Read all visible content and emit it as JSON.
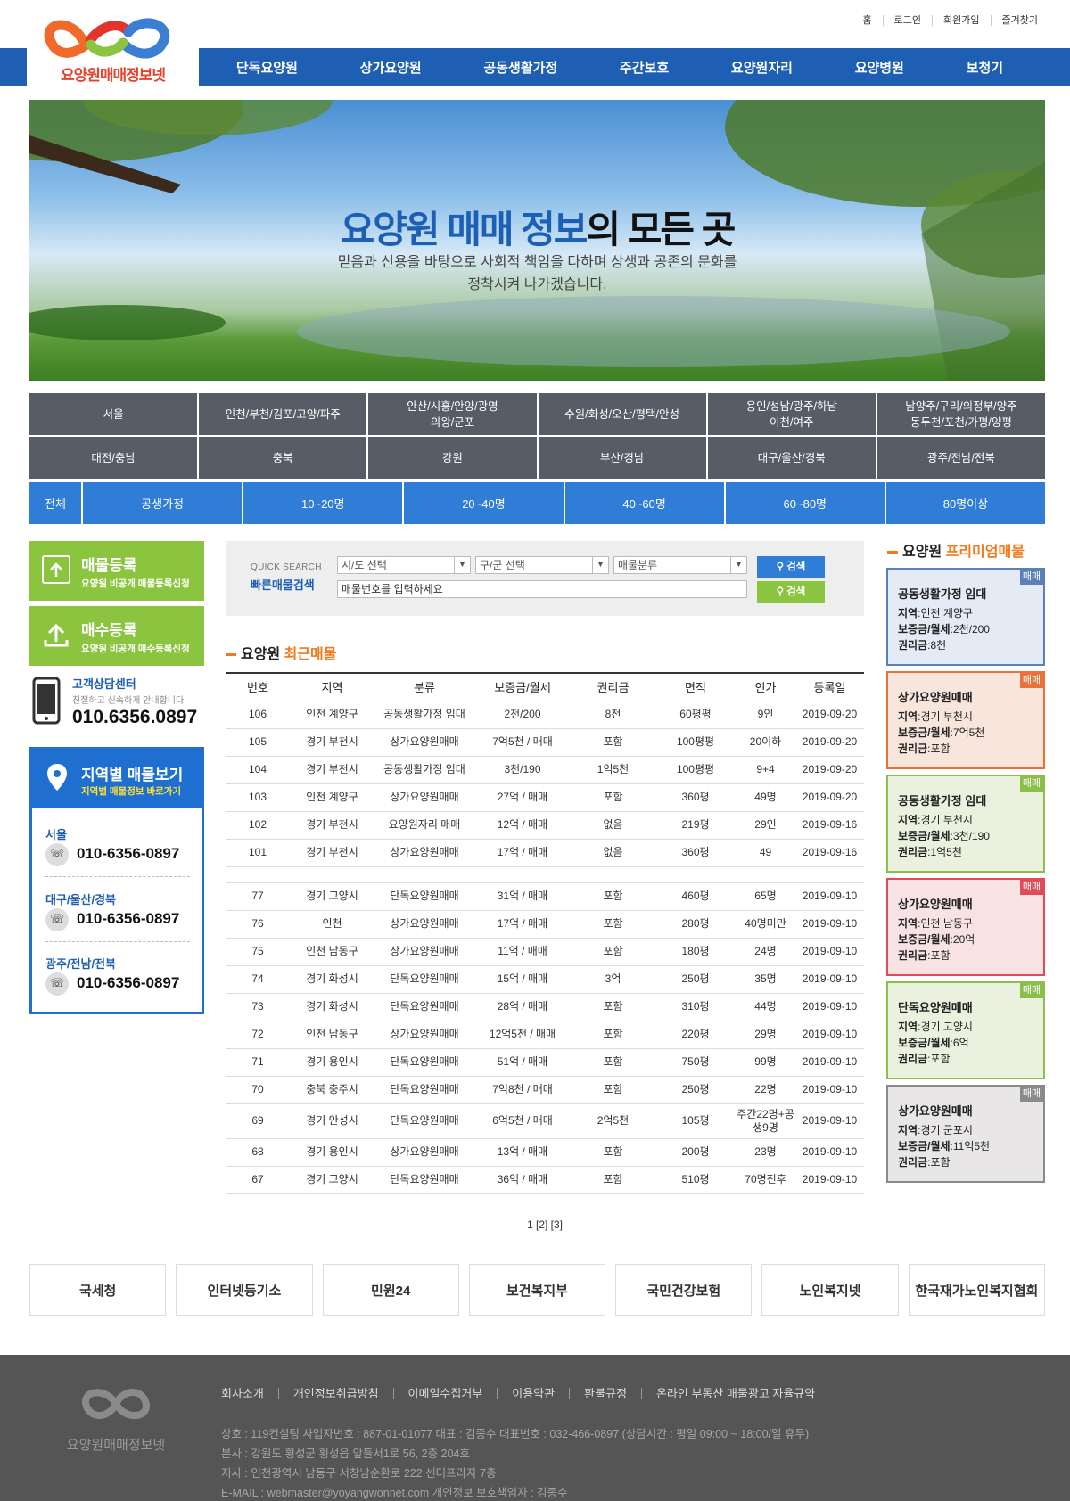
{
  "top_links": [
    "홈",
    "로그인",
    "회원가입",
    "즐겨찾기"
  ],
  "logo": {
    "text": "요양원매매정보넷"
  },
  "nav": [
    "단독요양원",
    "상가요양원",
    "공동생활가정",
    "주간보호",
    "요양원자리",
    "요양병원",
    "보청기"
  ],
  "hero": {
    "title_blue": "요양원 매매 정보",
    "title_dark": "의 모든 곳",
    "sub1": "믿음과 신용을 바탕으로 사회적 책임을 다하며 상생과 공존의 문화를",
    "sub2": "정착시켜 나가겠습니다."
  },
  "regions_row1": [
    "서울",
    "인천/부천/김포/고양/파주",
    "안산/시흥/안양/광명\n의왕/군포",
    "수원/화성/오산/평택/안성",
    "용인/성남/광주/하남\n이천/여주",
    "남양주/구리/의정부/양주\n동두천/포천/가평/양평"
  ],
  "regions_row2": [
    "대전/충남",
    "충북",
    "강원",
    "부산/경남",
    "대구/울산/경북",
    "광주/전남/전북"
  ],
  "capacity": [
    "전체",
    "공생가정",
    "10~20명",
    "20~40명",
    "40~60명",
    "60~80명",
    "80명이상"
  ],
  "side": {
    "register_title": "매물등록",
    "register_sub": "요양원 비공개 매물등록신청",
    "buy_title": "매수등록",
    "buy_sub": "요양원 비공개 매수등록신청",
    "cs_title": "고객상담센터",
    "cs_sub": "친절하고 신속하게 안내합니다.",
    "cs_phone": "010.6356.0897",
    "region_title": "지역별 매물보기",
    "region_sub": "지역별 매물정보 바로가기",
    "contacts": [
      {
        "area": "서울",
        "phone": "010-6356-0897"
      },
      {
        "area": "대구/울산/경북",
        "phone": "010-6356-0897"
      },
      {
        "area": "광주/전남/전북",
        "phone": "010-6356-0897"
      }
    ]
  },
  "search": {
    "label_en": "QUICK SEARCH",
    "label_ko": "빠른매물검색",
    "sel1": "시/도 선택",
    "sel2": "구/군 선택",
    "sel3": "매물분류",
    "input_placeholder": "매물번호를 입력하세요",
    "btn": "검색"
  },
  "recent": {
    "title_a": "요양원 ",
    "title_b": "최근매물",
    "headers": [
      "번호",
      "지역",
      "분류",
      "보증금/월세",
      "권리금",
      "면적",
      "인가",
      "등록일"
    ],
    "rows1": [
      [
        "106",
        "인천 계양구",
        "공동생활가정 임대",
        "2천/200",
        "8천",
        "60평평",
        "9인",
        "2019-09-20"
      ],
      [
        "105",
        "경기 부천시",
        "상가요양원매매",
        "7억5천 / 매매",
        "포함",
        "100평평",
        "20이하",
        "2019-09-20"
      ],
      [
        "104",
        "경기 부천시",
        "공동생활가정 임대",
        "3천/190",
        "1억5천",
        "100평평",
        "9+4",
        "2019-09-20"
      ],
      [
        "103",
        "인천 계양구",
        "상가요양원매매",
        "27억 / 매매",
        "포함",
        "360평",
        "49명",
        "2019-09-20"
      ],
      [
        "102",
        "경기 부천시",
        "요양원자리 매매",
        "12억 / 매매",
        "없음",
        "219평",
        "29인",
        "2019-09-16"
      ],
      [
        "101",
        "경기 부천시",
        "상가요양원매매",
        "17억 / 매매",
        "없음",
        "360평",
        "49",
        "2019-09-16"
      ]
    ],
    "rows2": [
      [
        "77",
        "경기 고양시",
        "단독요양원매매",
        "31억 / 매매",
        "포함",
        "460평",
        "65명",
        "2019-09-10"
      ],
      [
        "76",
        "인천",
        "상가요양원매매",
        "17억 / 매매",
        "포함",
        "280평",
        "40명미만",
        "2019-09-10"
      ],
      [
        "75",
        "인천 남동구",
        "상가요양원매매",
        "11억 / 매매",
        "포함",
        "180평",
        "24명",
        "2019-09-10"
      ],
      [
        "74",
        "경기 화성시",
        "단독요양원매매",
        "15억 / 매매",
        "3억",
        "250평",
        "35명",
        "2019-09-10"
      ],
      [
        "73",
        "경기 화성시",
        "단독요양원매매",
        "28억 / 매매",
        "포함",
        "310평",
        "44명",
        "2019-09-10"
      ],
      [
        "72",
        "인천 남동구",
        "상가요양원매매",
        "12억5천 / 매매",
        "포함",
        "220평",
        "29명",
        "2019-09-10"
      ],
      [
        "71",
        "경기 용인시",
        "단독요양원매매",
        "51억 / 매매",
        "포함",
        "750평",
        "99명",
        "2019-09-10"
      ],
      [
        "70",
        "충북 충주시",
        "단독요양원매매",
        "7억8천 / 매매",
        "포함",
        "250평",
        "22명",
        "2019-09-10"
      ],
      [
        "69",
        "경기 안성시",
        "단독요양원매매",
        "6억5천 / 매매",
        "2억5천",
        "105평",
        "주간22명+공\n생9명",
        "2019-09-10"
      ],
      [
        "68",
        "경기 용인시",
        "상가요양원매매",
        "13억 / 매매",
        "포함",
        "200평",
        "23명",
        "2019-09-10"
      ],
      [
        "67",
        "경기 고양시",
        "단독요양원매매",
        "36억 / 매매",
        "포함",
        "510평",
        "70명전후",
        "2019-09-10"
      ]
    ],
    "pager": "1  [2]  [3]"
  },
  "premium": {
    "title_a": "요양원 ",
    "title_b": "프리미엄매물",
    "cards": [
      {
        "title": "공동생활가정 임대",
        "tag": "매매",
        "region": "인천 계양구",
        "deposit": "2천/200",
        "premium": "8천",
        "color": "#5b7fb8",
        "bg": "#e4ebf5"
      },
      {
        "title": "상가요양원매매",
        "tag": "매매",
        "region": "경기 부천시",
        "deposit": "7억5천",
        "premium": "포함",
        "color": "#e8723a",
        "bg": "#f8e6dd"
      },
      {
        "title": "공동생활가정 임대",
        "tag": "매매",
        "region": "경기 부천시",
        "deposit": "3천/190",
        "premium": "1억5천",
        "color": "#8bbf4a",
        "bg": "#eaf2df"
      },
      {
        "title": "상가요양원매매",
        "tag": "매매",
        "region": "인천 남동구",
        "deposit": "20억",
        "premium": "포함",
        "color": "#e04a59",
        "bg": "#f8e2e3"
      },
      {
        "title": "단독요양원매매",
        "tag": "매매",
        "region": "경기 고양시",
        "deposit": "6억",
        "premium": "포함",
        "color": "#8bbf4a",
        "bg": "#eaf2df"
      },
      {
        "title": "상가요양원매매",
        "tag": "매매",
        "region": "경기 군포시",
        "deposit": "11억5천",
        "premium": "포함",
        "color": "#8a8a8a",
        "bg": "#e8e6e6"
      }
    ],
    "labels": {
      "region": "지역",
      "deposit": "보증금/월세",
      "premium": "권리금"
    }
  },
  "partners": [
    "국세청",
    "인터넷등기소",
    "민원24",
    "보건복지부",
    "국민건강보험",
    "노인복지넷",
    "한국재가노인복지협회"
  ],
  "footer": {
    "links": [
      "회사소개",
      "개인정보취급방침",
      "이메일수집거부",
      "이용약관",
      "환불규정",
      "온라인 부동산 매물광고 자율규약"
    ],
    "line1": "상호 : 119컨설팅   사업자번호 : 887-01-01077   대표 : 김종수   대표번호 : 032-466-0897  (상담시간 : 평일 09:00 ~ 18:00/일 휴무)",
    "line2": "본사 : 강원도 횡성군 횡성읍 앞들서1로 56, 2층 204호",
    "line3": "지사 : 인천광역시 남동구 서창남순환로 222 센터프라자 7층",
    "line4": "E-MAIL : webmaster@yoyangwonnet.com   개인정보 보호책임자 : 김종수",
    "logo_text": "요양원매매정보넷"
  }
}
